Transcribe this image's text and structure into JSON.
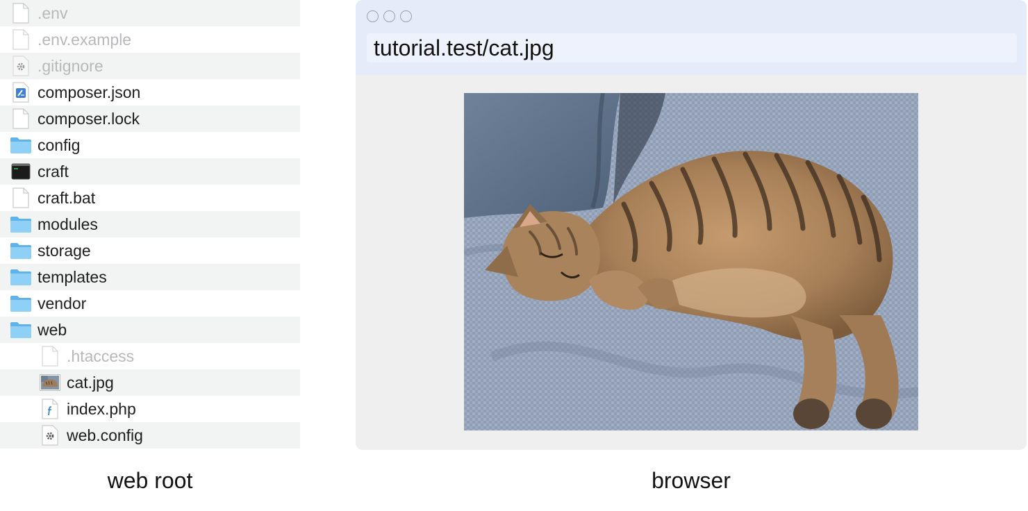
{
  "file_list": {
    "items": [
      {
        "name": ".env",
        "icon": "document-icon",
        "dim": true
      },
      {
        "name": ".env.example",
        "icon": "document-icon",
        "dim": true
      },
      {
        "name": ".gitignore",
        "icon": "gear-document-icon",
        "dim": true
      },
      {
        "name": "composer.json",
        "icon": "json-document-icon",
        "dim": false
      },
      {
        "name": "composer.lock",
        "icon": "document-icon",
        "dim": false
      },
      {
        "name": "config",
        "icon": "folder-icon",
        "dim": false
      },
      {
        "name": "craft",
        "icon": "terminal-icon",
        "dim": false
      },
      {
        "name": "craft.bat",
        "icon": "document-icon",
        "dim": false
      },
      {
        "name": "modules",
        "icon": "folder-icon",
        "dim": false
      },
      {
        "name": "storage",
        "icon": "folder-icon",
        "dim": false
      },
      {
        "name": "templates",
        "icon": "folder-icon",
        "dim": false
      },
      {
        "name": "vendor",
        "icon": "folder-icon",
        "dim": false
      },
      {
        "name": "web",
        "icon": "folder-icon",
        "dim": false
      },
      {
        "name": ".htaccess",
        "icon": "document-icon",
        "dim": true
      },
      {
        "name": "cat.jpg",
        "icon": "image-thumbnail-icon",
        "dim": false
      },
      {
        "name": "index.php",
        "icon": "php-document-icon",
        "dim": false
      },
      {
        "name": "web.config",
        "icon": "gear-document-icon",
        "dim": false
      }
    ]
  },
  "browser": {
    "url": "tutorial.test/cat.jpg",
    "window_buttons": [
      "close",
      "minimize",
      "zoom"
    ]
  },
  "captions": {
    "left": "web root",
    "right": "browser"
  },
  "colors": {
    "row_stripe": "#f2f3f3",
    "dim_text": "#b8b8bb",
    "folder": "#74c3f3",
    "browser_chrome": "#e5ebf8",
    "browser_body": "#efefef"
  }
}
